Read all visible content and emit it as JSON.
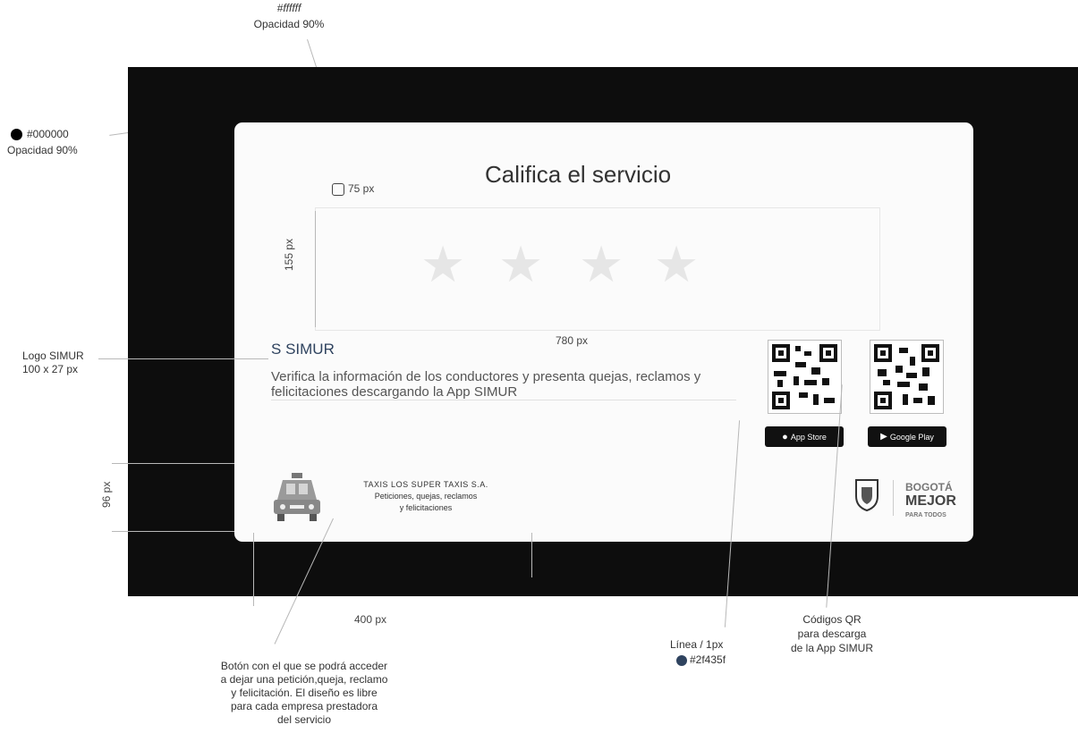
{
  "annotations": {
    "white_hex": "#ffffff",
    "white_opacity": "Opacidad 90%",
    "black_hex": "#000000",
    "black_opacity": "Opacidad 90%",
    "star_size": "75 px",
    "box_height": "155 px",
    "box_width": "780 px",
    "logo_label": "Logo SIMUR",
    "logo_size": "100 x 27 px",
    "footer_height": "96 px",
    "button_width": "400 px",
    "line_label": "Línea / 1px",
    "line_color": "#2f435f",
    "qr_label_1": "Códigos QR",
    "qr_label_2": "para descarga",
    "qr_label_3": "de la App SIMUR",
    "button_note_1": "Botón con el que se podrá acceder",
    "button_note_2": "a dejar una petición,queja, reclamo",
    "button_note_3": "y felicitación. El diseño es libre",
    "button_note_4": "para cada empresa prestadora",
    "button_note_5": "del servicio"
  },
  "modal": {
    "title": "Califica el servicio",
    "star_glyph": "★",
    "rating_stars": 4,
    "simur_logo": "SIMUR",
    "simur_text": "Verifica la información de los conductores y presenta quejas, reclamos y felicitaciones descargando la App SIMUR",
    "app_store": "App Store",
    "google_play": "Google Play",
    "company_name": "TAXIS LOS SUPER TAXIS S.A.",
    "company_line2": "Peticiones, quejas, reclamos",
    "company_line3": "y felicitaciones",
    "bogota_top": "BOGOTÁ",
    "bogota_main": "MEJOR",
    "bogota_sub": "PARA TODOS"
  },
  "colors": {
    "overlay": "#000000",
    "card": "#ffffff",
    "line": "#2f435f"
  }
}
